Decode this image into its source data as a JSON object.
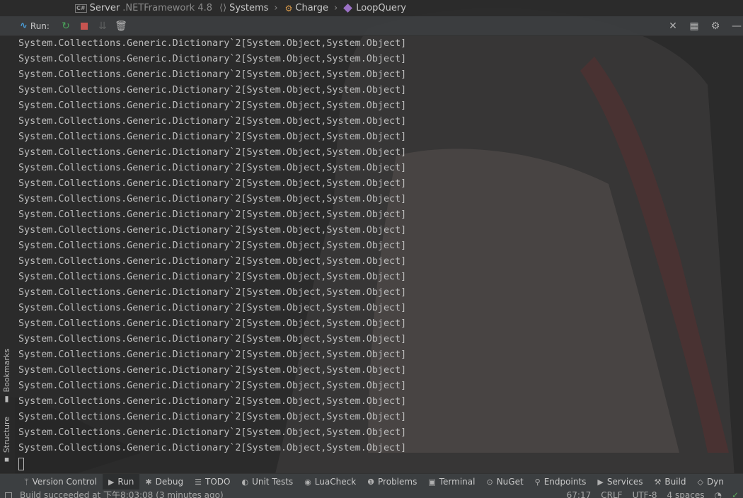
{
  "breadcrumb": {
    "project": "Server",
    "framework": ".NETFramework 4.8",
    "items": [
      "Systems",
      "Charge",
      "LoopQuery"
    ]
  },
  "run_toolbar": {
    "label": "Run:"
  },
  "left_strip": {
    "bookmarks": "Bookmarks",
    "structure": "Structure"
  },
  "console": {
    "lines": [
      "System.Collections.Generic.Dictionary`2[System.Object,System.Object]",
      "System.Collections.Generic.Dictionary`2[System.Object,System.Object]",
      "System.Collections.Generic.Dictionary`2[System.Object,System.Object]",
      "System.Collections.Generic.Dictionary`2[System.Object,System.Object]",
      "System.Collections.Generic.Dictionary`2[System.Object,System.Object]",
      "System.Collections.Generic.Dictionary`2[System.Object,System.Object]",
      "System.Collections.Generic.Dictionary`2[System.Object,System.Object]",
      "System.Collections.Generic.Dictionary`2[System.Object,System.Object]",
      "System.Collections.Generic.Dictionary`2[System.Object,System.Object]",
      "System.Collections.Generic.Dictionary`2[System.Object,System.Object]",
      "System.Collections.Generic.Dictionary`2[System.Object,System.Object]",
      "System.Collections.Generic.Dictionary`2[System.Object,System.Object]",
      "System.Collections.Generic.Dictionary`2[System.Object,System.Object]",
      "System.Collections.Generic.Dictionary`2[System.Object,System.Object]",
      "System.Collections.Generic.Dictionary`2[System.Object,System.Object]",
      "System.Collections.Generic.Dictionary`2[System.Object,System.Object]",
      "System.Collections.Generic.Dictionary`2[System.Object,System.Object]",
      "System.Collections.Generic.Dictionary`2[System.Object,System.Object]",
      "System.Collections.Generic.Dictionary`2[System.Object,System.Object]",
      "System.Collections.Generic.Dictionary`2[System.Object,System.Object]",
      "System.Collections.Generic.Dictionary`2[System.Object,System.Object]",
      "System.Collections.Generic.Dictionary`2[System.Object,System.Object]",
      "System.Collections.Generic.Dictionary`2[System.Object,System.Object]",
      "System.Collections.Generic.Dictionary`2[System.Object,System.Object]",
      "System.Collections.Generic.Dictionary`2[System.Object,System.Object]",
      "System.Collections.Generic.Dictionary`2[System.Object,System.Object]",
      "System.Collections.Generic.Dictionary`2[System.Object,System.Object]"
    ]
  },
  "tool_tabs": [
    {
      "label": "Version Control",
      "icon": "branch-icon"
    },
    {
      "label": "Run",
      "icon": "play-icon",
      "active": true
    },
    {
      "label": "Debug",
      "icon": "bug-icon"
    },
    {
      "label": "TODO",
      "icon": "list-icon"
    },
    {
      "label": "Unit Tests",
      "icon": "unit-tests-icon"
    },
    {
      "label": "LuaCheck",
      "icon": "lua-icon"
    },
    {
      "label": "Problems",
      "icon": "problems-icon"
    },
    {
      "label": "Terminal",
      "icon": "terminal-icon"
    },
    {
      "label": "NuGet",
      "icon": "nuget-icon"
    },
    {
      "label": "Endpoints",
      "icon": "endpoints-icon"
    },
    {
      "label": "Services",
      "icon": "services-icon"
    },
    {
      "label": "Build",
      "icon": "hammer-icon"
    },
    {
      "label": "Dyn",
      "icon": "dyn-icon"
    }
  ],
  "status_bar": {
    "message": "Build succeeded at 下午8:03:08  (3 minutes ago)",
    "position": "67:17",
    "line_ending": "CRLF",
    "encoding": "UTF-8",
    "indent": "4 spaces"
  },
  "colors": {
    "background": "#2b2b2b",
    "toolbar": "#3c3f41",
    "rerun": "#49a35a",
    "stop": "#c75450"
  }
}
